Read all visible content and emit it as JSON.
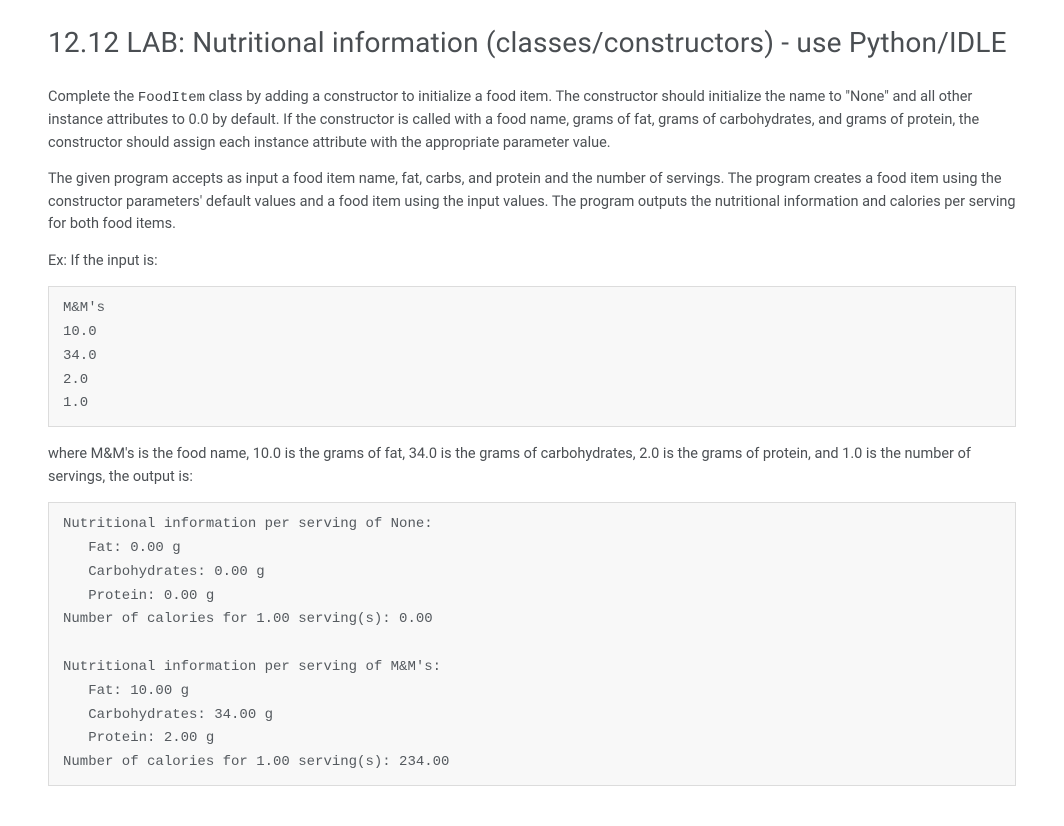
{
  "title": "12.12 LAB: Nutritional information (classes/constructors) - use Python/IDLE",
  "paragraphs": {
    "p1_pre": "Complete the ",
    "p1_code": "FoodItem",
    "p1_post": " class by adding a constructor to initialize a food item. The constructor should initialize the name to \"None\" and all other instance attributes to 0.0 by default. If the constructor is called with a food name, grams of fat, grams of carbohydrates, and grams of protein, the constructor should assign each instance attribute with the appropriate parameter value.",
    "p2": "The given program accepts as input a food item name, fat, carbs, and protein and the number of servings. The program creates a food item using the constructor parameters' default values and a food item using the input values. The program outputs the nutritional information and calories per serving for both food items.",
    "p3": "Ex: If the input is:",
    "p4": "where M&M's is the food name, 10.0 is the grams of fat, 34.0 is the grams of carbohydrates, 2.0 is the grams of protein, and 1.0 is the number of servings, the output is:"
  },
  "input_block": "M&M's\n10.0\n34.0\n2.0\n1.0",
  "output_block": "Nutritional information per serving of None:\n   Fat: 0.00 g\n   Carbohydrates: 0.00 g\n   Protein: 0.00 g\nNumber of calories for 1.00 serving(s): 0.00\n\nNutritional information per serving of M&M's:\n   Fat: 10.00 g\n   Carbohydrates: 34.00 g\n   Protein: 2.00 g\nNumber of calories for 1.00 serving(s): 234.00"
}
